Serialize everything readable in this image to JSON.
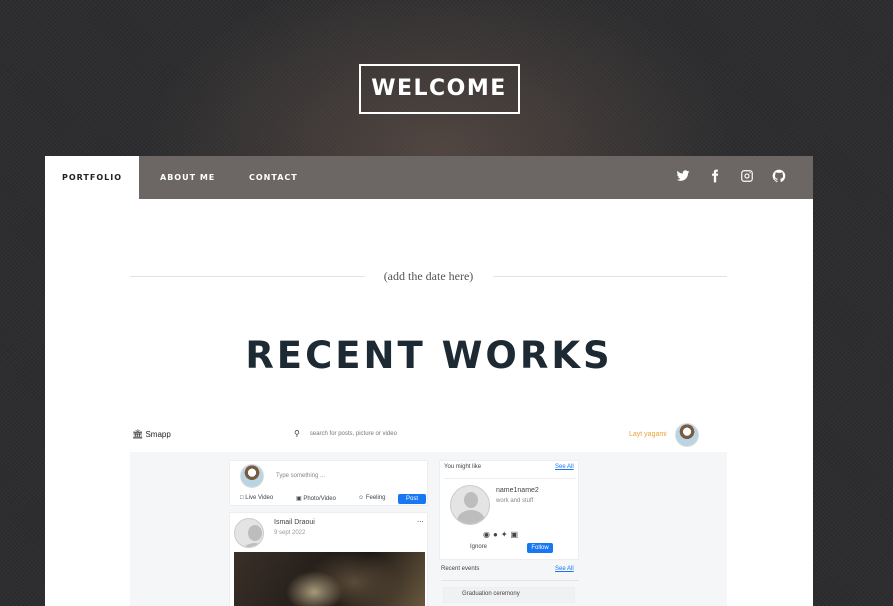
{
  "welcome": {
    "label": "WELCOME"
  },
  "nav": {
    "tabs": [
      {
        "label": "PORTFOLIO",
        "active": true
      },
      {
        "label": "ABOUT ME",
        "active": false
      },
      {
        "label": "CONTACT",
        "active": false
      }
    ],
    "social_icons": [
      "twitter-icon",
      "facebook-icon",
      "instagram-icon",
      "github-icon"
    ]
  },
  "date_placeholder": "(add the date here)",
  "section_title": "RECENT WORKS",
  "project_preview": {
    "app_name": "Smapp",
    "search_placeholder": "search for posts, picture or video",
    "user_name": "Layt yagami",
    "composer": {
      "placeholder": "Type something ...",
      "live_video": "Live Video",
      "photo_video": "Photo/Video",
      "feeling": "Feeling",
      "post_button": "Post"
    },
    "post": {
      "author": "Ismail Draoui",
      "date": "9 sept 2022",
      "more": "..."
    },
    "suggestions": {
      "title": "You might like",
      "see_all": "See All",
      "name": "name1name2",
      "subtitle": "work and stuff",
      "ignore": "Ignore",
      "follow": "Follow"
    },
    "events": {
      "title": "Recent events",
      "see_all": "See All",
      "item": "Graduation ceremony"
    }
  },
  "colors": {
    "accent": "#1877f2",
    "username": "#e8a23a",
    "heading": "#1d2a33"
  }
}
